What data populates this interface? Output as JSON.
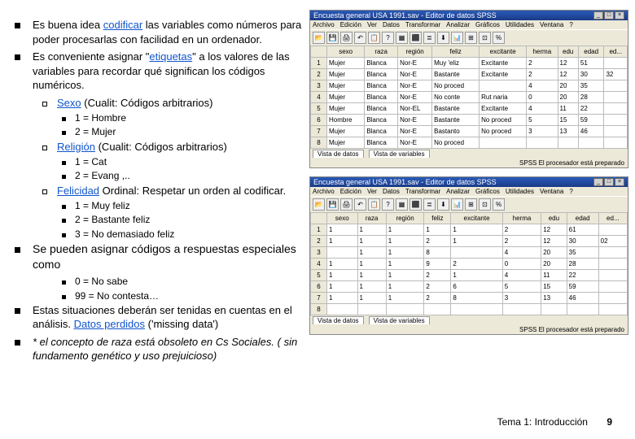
{
  "bullets": {
    "b1a": "Es buena idea ",
    "b1_link": "codificar",
    "b1b": " las variables como números para poder procesarlas con facilidad en un ordenador.",
    "b2a": "Es conveniente asignar \"",
    "b2_link": "etiquetas",
    "b2b": "\" a los valores de las variables para recordar qué significan los códigos numéricos.",
    "b2s1a": "Sexo",
    "b2s1b": " (Cualit: Códigos arbitrarios)",
    "b2s1_1": "1 = Hombre",
    "b2s1_2": "2 = Mujer",
    "b2s2a": "Religión",
    "b2s2b": " (Cualit: Códigos arbitrarios)",
    "b2s2_1": "1 = Cat",
    "b2s2_2": "2 = Evang ,..",
    "b2s3a": "Felicidad",
    "b2s3b": " Ordinal: Respetar un orden al codificar.",
    "b2s3_1": "1 = Muy feliz",
    "b2s3_2": "2 = Bastante feliz",
    "b2s3_3": "3 = No demasiado feliz",
    "b3": "Se pueden asignar códigos a respuestas especiales como",
    "b3_1": "0 = No sabe",
    "b3_2": "99 = No contesta…",
    "b4a": "Estas situaciones deberán ser tenidas en cuentas en el análisis. ",
    "b4_link": "Datos perdidos",
    "b4b": " ('missing data')",
    "b5": "* el concepto de raza está obsoleto en Cs Sociales. ( sin fundamento genético y   uso prejuicioso)"
  },
  "footer": {
    "topic": "Tema 1: Introducción",
    "page": "9"
  },
  "app1": {
    "title": "Encuesta general USA 1991.sav - Editor de datos SPSS",
    "menus": [
      "Archivo",
      "Edición",
      "Ver",
      "Datos",
      "Transformar",
      "Analizar",
      "Gráficos",
      "Utilidades",
      "Ventana",
      "?"
    ],
    "toolicons": [
      "📂",
      "💾",
      "🖨",
      "↶",
      "📋",
      "?",
      "▦",
      "⬛",
      "≣",
      "⬇",
      "📊",
      "⊞",
      "⊡",
      "%"
    ],
    "headers": [
      "",
      "sexo",
      "raza",
      "región",
      "feliz",
      "excitante",
      "herma",
      "edu",
      "edad",
      "ed..."
    ],
    "rows": [
      [
        "1",
        "Mujer",
        "Blanca",
        "Nor-E",
        "Muy 'eliz",
        "Excitante",
        "2",
        "12",
        "51",
        ""
      ],
      [
        "2",
        "Mujer",
        "Blanca",
        "Nor-E",
        "Bastante",
        "Excitante",
        "2",
        "12",
        "30",
        "32"
      ],
      [
        "3",
        "Mujer",
        "Blanca",
        "Nor-E",
        "No proced",
        "",
        "4",
        "20",
        "35",
        ""
      ],
      [
        "4",
        "Mujer",
        "Blanca",
        "Nor-E",
        "No conte",
        "Rut naria",
        "0",
        "20",
        "28",
        ""
      ],
      [
        "5",
        "Mujer",
        "Blanca",
        "Nor-EL",
        "Bastante",
        "Excitante",
        "4",
        "11",
        "22",
        ""
      ],
      [
        "6",
        "Hombre",
        "Blanca",
        "Nor-E",
        "Bastante",
        "No proced",
        "5",
        "15",
        "59",
        ""
      ],
      [
        "7",
        "Mujer",
        "Blanca",
        "Nor-E",
        "Bastanto",
        "No proced",
        "3",
        "13",
        "46",
        ""
      ],
      [
        "8",
        "Mujer",
        "Blanca",
        "Nor-E",
        "No proced",
        "",
        "",
        "",
        "",
        ""
      ]
    ],
    "tabs": [
      "Vista de datos",
      "Vista de variables"
    ],
    "status_l": "",
    "status_r": "SPSS El procesador está preparado"
  },
  "app2": {
    "title": "Encuesta general USA 1991.sav - Editor de datos SPSS",
    "menus": [
      "Archivo",
      "Edición",
      "Ver",
      "Datos",
      "Transformar",
      "Analizar",
      "Gráficos",
      "Utilidades",
      "Ventana",
      "?"
    ],
    "toolicons": [
      "📂",
      "💾",
      "🖨",
      "↶",
      "📋",
      "?",
      "▦",
      "⬛",
      "≣",
      "⬇",
      "📊",
      "⊞",
      "⊡",
      "%"
    ],
    "headers": [
      "",
      "sexo",
      "raza",
      "región",
      "feliz",
      "excitante",
      "herma",
      "edu",
      "edad",
      "ed..."
    ],
    "rows": [
      [
        "1",
        "1",
        "1",
        "1",
        "1",
        "1",
        "2",
        "12",
        "61",
        ""
      ],
      [
        "2",
        "1",
        "1",
        "1",
        "2",
        "1",
        "2",
        "12",
        "30",
        "02"
      ],
      [
        "3",
        "",
        "1",
        "1",
        "8",
        "",
        "4",
        "20",
        "35",
        ""
      ],
      [
        "4",
        "1",
        "1",
        "1",
        "9",
        "2",
        "0",
        "20",
        "28",
        ""
      ],
      [
        "5",
        "1",
        "1",
        "1",
        "2",
        "1",
        "4",
        "11",
        "22",
        ""
      ],
      [
        "6",
        "1",
        "1",
        "1",
        "2",
        "6",
        "5",
        "15",
        "59",
        ""
      ],
      [
        "7",
        "1",
        "1",
        "1",
        "2",
        "8",
        "3",
        "13",
        "46",
        ""
      ],
      [
        "8",
        "",
        "",
        "",
        "",
        "",
        "",
        "",
        "",
        ""
      ]
    ],
    "tabs": [
      "Vista de datos",
      "Vista de variables"
    ],
    "status_l": "",
    "status_r": "SPSS El procesador está preparado"
  }
}
